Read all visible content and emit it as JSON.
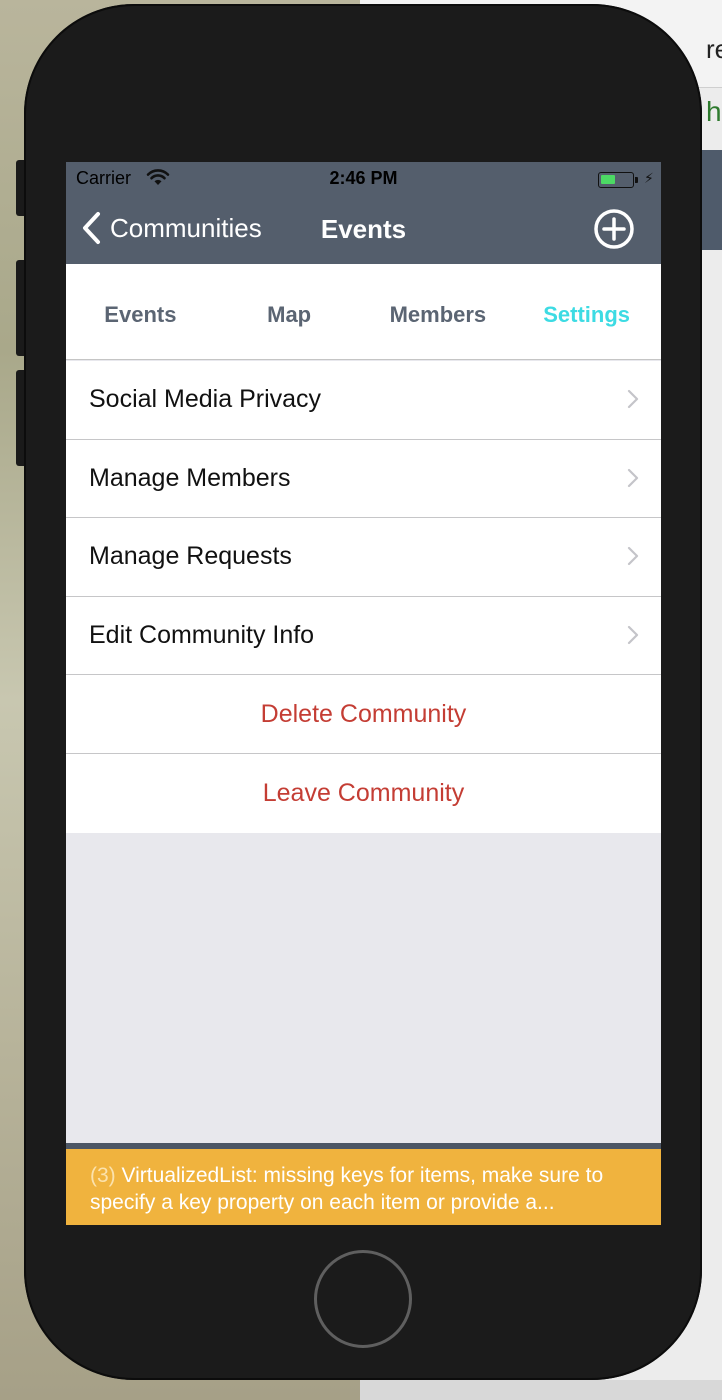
{
  "status_bar": {
    "carrier": "Carrier",
    "time": "2:46 PM"
  },
  "nav": {
    "back_label": "Communities",
    "title": "Events",
    "add_icon": "plus-circle-icon"
  },
  "tabs": [
    {
      "label": "Events",
      "active": false
    },
    {
      "label": "Map",
      "active": false
    },
    {
      "label": "Members",
      "active": false
    },
    {
      "label": "Settings",
      "active": true
    }
  ],
  "settings": {
    "items": [
      {
        "label": "Social Media Privacy"
      },
      {
        "label": "Manage Members"
      },
      {
        "label": "Manage Requests"
      },
      {
        "label": "Edit Community Info"
      }
    ],
    "actions": [
      {
        "label": "Delete Community"
      },
      {
        "label": "Leave Community"
      }
    ]
  },
  "warning": {
    "count": "(3)",
    "message": "VirtualizedList: missing keys for items, make sure to specify a key property on each item or provide a..."
  },
  "background_window": {
    "tab_text": "re",
    "address_text": "h"
  },
  "colors": {
    "nav_bar": "#545e6c",
    "active_tab": "#3ddbe3",
    "inactive_tab": "#5b6573",
    "destructive": "#c43d34",
    "warning": "#f0b33e"
  }
}
